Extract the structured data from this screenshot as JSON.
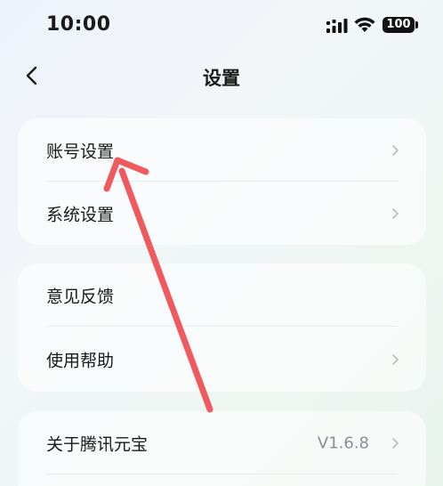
{
  "status_bar": {
    "time": "10:00",
    "battery": "100",
    "icons": [
      "signal-icon",
      "wifi-icon",
      "battery-icon"
    ]
  },
  "nav": {
    "title": "设置",
    "back_icon": "chevron-left-icon"
  },
  "groups": [
    {
      "items": [
        {
          "label": "账号设置",
          "has_chevron": true
        },
        {
          "label": "系统设置",
          "has_chevron": true
        }
      ]
    },
    {
      "items": [
        {
          "label": "意见反馈",
          "has_chevron": false
        },
        {
          "label": "使用帮助",
          "has_chevron": true
        }
      ]
    },
    {
      "items": [
        {
          "label": "关于腾讯元宝",
          "value": "V1.6.8",
          "has_chevron": true
        }
      ]
    }
  ],
  "colors": {
    "annotation_arrow": "#ee5a5e",
    "chevron": "#b8bcc2",
    "value_text": "#8a8f96"
  }
}
